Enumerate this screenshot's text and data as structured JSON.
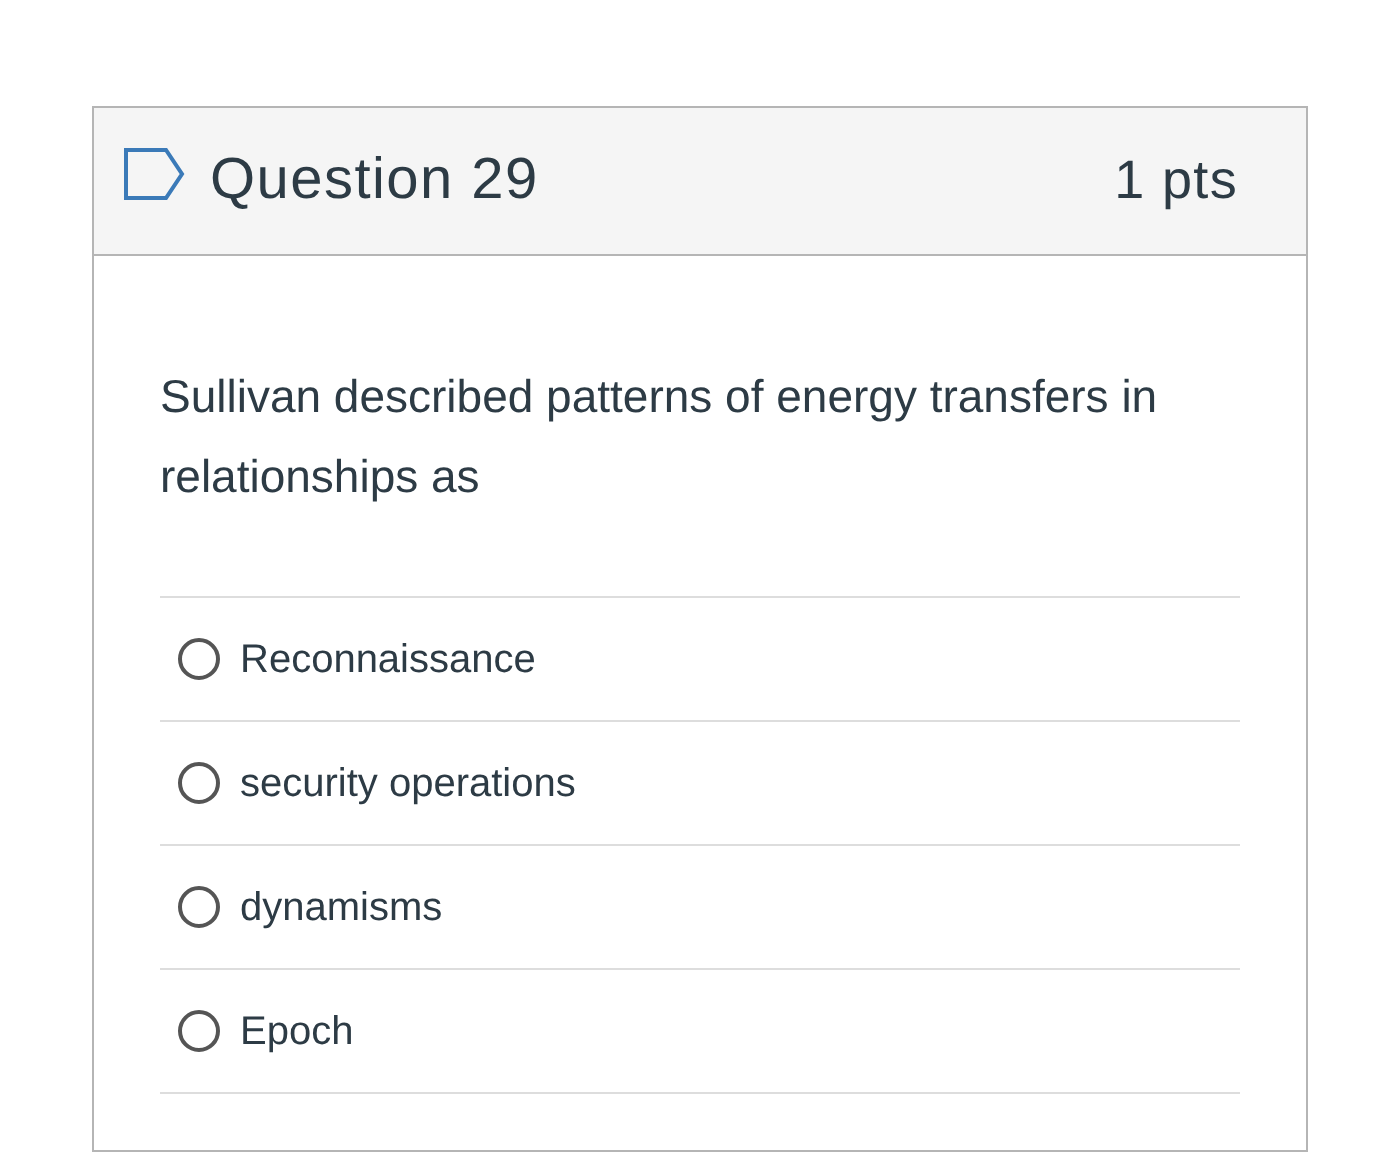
{
  "question": {
    "title": "Question 29",
    "points": "1 pts",
    "text": "Sullivan described patterns of energy transfers in relationships as",
    "options": [
      {
        "label": "Reconnaissance",
        "selected": false
      },
      {
        "label": "security operations",
        "selected": false
      },
      {
        "label": "dynamisms",
        "selected": false
      },
      {
        "label": "Epoch",
        "selected": false
      }
    ]
  }
}
